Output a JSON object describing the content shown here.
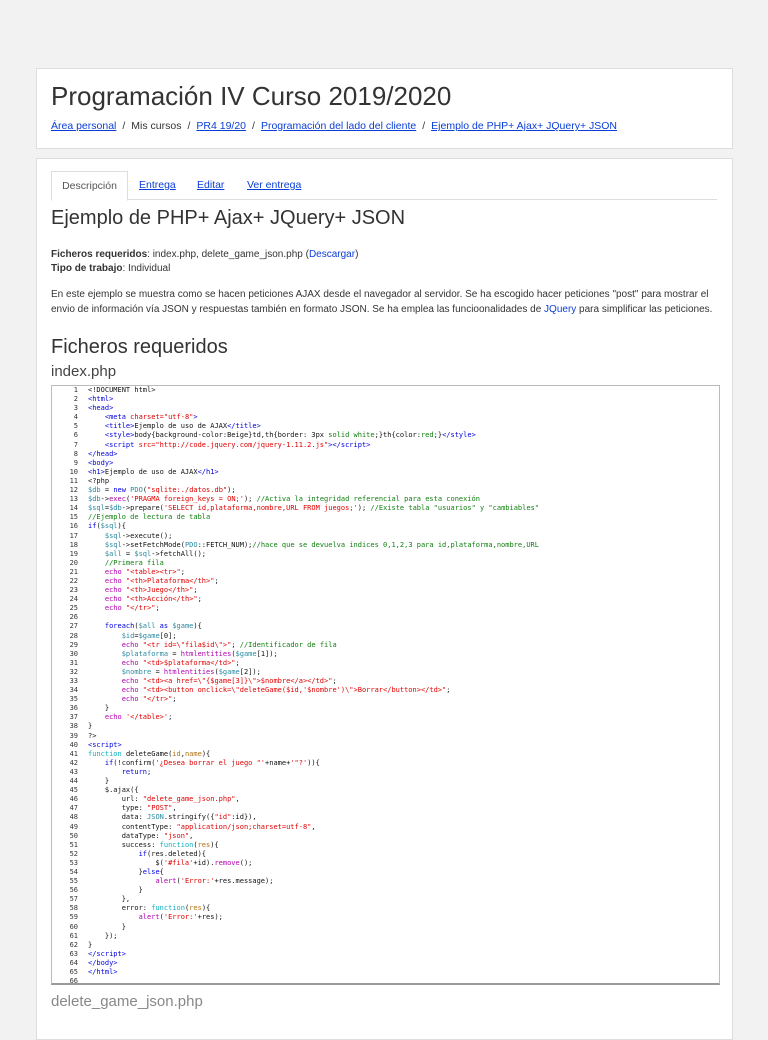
{
  "header": {
    "title": "Programación IV Curso 2019/2020",
    "breadcrumb": [
      "Área personal",
      "Mis cursos",
      "PR4 19/20",
      "Programación del lado del cliente",
      "Ejemplo de PHP+ Ajax+ JQuery+ JSON"
    ]
  },
  "tabs": [
    "Descripción",
    "Entrega",
    "Editar",
    "Ver entrega"
  ],
  "assignment": {
    "title": "Ejemplo de PHP+ Ajax+ JQuery+ JSON",
    "files_label": "Ficheros requeridos",
    "files_value": ": index.php, delete_game_json.php (",
    "download_link": "Descargar",
    "files_close": ")",
    "type_label": "Tipo de trabajo",
    "type_value": ": Individual",
    "description_pre": "En este ejemplo se muestra como se hacen peticiones AJAX  desde el navegador al servidor. Se ha escogido hacer peticiones \"post\" para mostrar el envio de información vía JSON y respuestas también en formato JSON. Se ha emplea las funcioonalidades de ",
    "description_link": "JQuery",
    "description_post": " para simplificar las peticiones.",
    "section_title": "Ficheros requeridos",
    "file1_name": "index.php",
    "file2_name": "delete_game_json.php"
  },
  "code_lines": [
    [
      [
        "",
        "<!DOCUMENT html>"
      ]
    ],
    [
      [
        "t",
        "<html>"
      ]
    ],
    [
      [
        "t",
        "<head>"
      ]
    ],
    [
      [
        "",
        "    "
      ],
      [
        "t",
        "<meta "
      ],
      [
        "s",
        "charset=\"utf-8\""
      ],
      [
        "t",
        ">"
      ]
    ],
    [
      [
        "",
        "    "
      ],
      [
        "t",
        "<title>"
      ],
      [
        "",
        "Ejemplo de uso de AJAX"
      ],
      [
        "t",
        "</title>"
      ]
    ],
    [
      [
        "",
        "    "
      ],
      [
        "t",
        "<style>"
      ],
      [
        "",
        "body{background-color:Beige}td,th{border: 3px "
      ],
      [
        "c",
        "solid white"
      ],
      [
        "",
        ";}th{color:"
      ],
      [
        "c",
        "red"
      ],
      [
        "",
        ";}"
      ],
      [
        "t",
        "</style>"
      ]
    ],
    [
      [
        "",
        "    "
      ],
      [
        "t",
        "<script "
      ],
      [
        "s",
        "src=\"http://code.jquery.com/jquery-1.11.2.js\""
      ],
      [
        "t",
        "></script>"
      ]
    ],
    [
      [
        "t",
        "</head>"
      ]
    ],
    [
      [
        "t",
        "<body>"
      ]
    ],
    [
      [
        "t",
        "<h1>"
      ],
      [
        "",
        "Ejemplo de uso de AJAX"
      ],
      [
        "t",
        "</h1>"
      ]
    ],
    [
      [
        "",
        "<?php"
      ]
    ],
    [
      [
        "v",
        "$db"
      ],
      [
        "",
        " = "
      ],
      [
        "t",
        "new "
      ],
      [
        "v",
        "PDO"
      ],
      [
        "",
        "("
      ],
      [
        "s",
        "\"sqlite:./datos.db\""
      ],
      [
        "",
        ");"
      ]
    ],
    [
      [
        "v",
        "$db"
      ],
      [
        "",
        "->"
      ],
      [
        "k",
        "exec"
      ],
      [
        "",
        "("
      ],
      [
        "s",
        "'PRAGMA foreign_keys = ON;'"
      ],
      [
        "",
        "); "
      ],
      [
        "c",
        "//Activa la integridad referencial para esta conexión"
      ]
    ],
    [
      [
        "v",
        "$sql"
      ],
      [
        "",
        "="
      ],
      [
        "v",
        "$db"
      ],
      [
        "",
        "->prepare("
      ],
      [
        "s",
        "'SELECT id,plataforma,nombre,URL FROM juegos;'"
      ],
      [
        "",
        "); "
      ],
      [
        "c",
        "//Existe tabla \"usuarios\" y \"cambiables\""
      ]
    ],
    [
      [
        "c",
        "//Ejemplo de lectura de tabla"
      ]
    ],
    [
      [
        "t",
        "if"
      ],
      [
        "",
        "("
      ],
      [
        "v",
        "$sql"
      ],
      [
        "",
        "){"
      ]
    ],
    [
      [
        "",
        "    "
      ],
      [
        "v",
        "$sql"
      ],
      [
        "",
        "->execute();"
      ]
    ],
    [
      [
        "",
        "    "
      ],
      [
        "v",
        "$sql"
      ],
      [
        "",
        "->setFetchMode("
      ],
      [
        "v",
        "PDO"
      ],
      [
        "",
        "::FETCH_NUM);"
      ],
      [
        "c",
        "//hace que se devuelva indices 0,1,2,3 para id,plataforma,nombre,URL"
      ]
    ],
    [
      [
        "",
        "    "
      ],
      [
        "v",
        "$all"
      ],
      [
        "",
        " = "
      ],
      [
        "v",
        "$sql"
      ],
      [
        "",
        "->fetchAll();"
      ]
    ],
    [
      [
        "",
        "    "
      ],
      [
        "c",
        "//Primera fila"
      ]
    ],
    [
      [
        "",
        "    "
      ],
      [
        "k",
        "echo "
      ],
      [
        "s",
        "\"<table><tr>\""
      ],
      [
        "",
        ";"
      ]
    ],
    [
      [
        "",
        "    "
      ],
      [
        "k",
        "echo "
      ],
      [
        "s",
        "\"<th>Plataforma</th>\""
      ],
      [
        "",
        ";"
      ]
    ],
    [
      [
        "",
        "    "
      ],
      [
        "k",
        "echo "
      ],
      [
        "s",
        "\"<th>Juego</th>\""
      ],
      [
        "",
        ";"
      ]
    ],
    [
      [
        "",
        "    "
      ],
      [
        "k",
        "echo "
      ],
      [
        "s",
        "\"<th>Acción</th>\""
      ],
      [
        "",
        ";"
      ]
    ],
    [
      [
        "",
        "    "
      ],
      [
        "k",
        "echo "
      ],
      [
        "s",
        "\"</tr>\""
      ],
      [
        "",
        ";"
      ]
    ],
    [
      [
        "",
        ""
      ]
    ],
    [
      [
        "",
        "    "
      ],
      [
        "t",
        "foreach"
      ],
      [
        "",
        "("
      ],
      [
        "v",
        "$all"
      ],
      [
        "t",
        " as "
      ],
      [
        "v",
        "$game"
      ],
      [
        "",
        "){"
      ]
    ],
    [
      [
        "",
        "        "
      ],
      [
        "v",
        "$id"
      ],
      [
        "",
        "="
      ],
      [
        "v",
        "$game"
      ],
      [
        "",
        "[0];"
      ]
    ],
    [
      [
        "",
        "        "
      ],
      [
        "k",
        "echo "
      ],
      [
        "s",
        "\"<tr id=\\\"fila$id\\\">\""
      ],
      [
        "",
        "; "
      ],
      [
        "c",
        "//Identificador de fila"
      ]
    ],
    [
      [
        "",
        "        "
      ],
      [
        "v",
        "$plataforma"
      ],
      [
        "",
        " = "
      ],
      [
        "k",
        "htmlentities"
      ],
      [
        "",
        "("
      ],
      [
        "v",
        "$game"
      ],
      [
        "",
        "[1]);"
      ]
    ],
    [
      [
        "",
        "        "
      ],
      [
        "k",
        "echo "
      ],
      [
        "s",
        "\"<td>$plataforma</td>\""
      ],
      [
        "",
        ";"
      ]
    ],
    [
      [
        "",
        "        "
      ],
      [
        "v",
        "$nombre"
      ],
      [
        "",
        " = "
      ],
      [
        "k",
        "htmlentities"
      ],
      [
        "",
        "("
      ],
      [
        "v",
        "$game"
      ],
      [
        "",
        "[2]);"
      ]
    ],
    [
      [
        "",
        "        "
      ],
      [
        "k",
        "echo "
      ],
      [
        "s",
        "\"<td><a href=\\\"{$game[3]}\\\">$nombre</a></td>\""
      ],
      [
        "",
        ";"
      ]
    ],
    [
      [
        "",
        "        "
      ],
      [
        "k",
        "echo "
      ],
      [
        "s",
        "\"<td><button onclick=\\\"deleteGame($id,'$nombre')\\\">Borrar</button></td>\""
      ],
      [
        "",
        ";"
      ]
    ],
    [
      [
        "",
        "        "
      ],
      [
        "k",
        "echo "
      ],
      [
        "s",
        "\"</tr>\""
      ],
      [
        "",
        ";"
      ]
    ],
    [
      [
        "",
        "    }"
      ]
    ],
    [
      [
        "",
        "    "
      ],
      [
        "k",
        "echo "
      ],
      [
        "s",
        "'</table>'"
      ],
      [
        "",
        ";"
      ]
    ],
    [
      [
        "",
        "}"
      ]
    ],
    [
      [
        "",
        "?>"
      ]
    ],
    [
      [
        "t",
        "<script>"
      ]
    ],
    [
      [
        "f",
        "function "
      ],
      [
        "",
        "deleteGame("
      ],
      [
        "p",
        "id"
      ],
      [
        "",
        ","
      ],
      [
        "p",
        "name"
      ],
      [
        "",
        "){"
      ]
    ],
    [
      [
        "",
        "    "
      ],
      [
        "t",
        "if"
      ],
      [
        "",
        "(!confirm("
      ],
      [
        "s",
        "'¿Desea borrar el juego \"'"
      ],
      [
        "",
        "+name+"
      ],
      [
        "s",
        "'\"?'"
      ],
      [
        "",
        ")){"
      ]
    ],
    [
      [
        "",
        "        "
      ],
      [
        "t",
        "return"
      ],
      [
        "",
        ";"
      ]
    ],
    [
      [
        "",
        "    }"
      ]
    ],
    [
      [
        "",
        "    $.ajax({"
      ]
    ],
    [
      [
        "",
        "        url: "
      ],
      [
        "s",
        "\"delete_game_json.php\""
      ],
      [
        "",
        ","
      ]
    ],
    [
      [
        "",
        "        type: "
      ],
      [
        "s",
        "\"POST\""
      ],
      [
        "",
        ","
      ]
    ],
    [
      [
        "",
        "        data: "
      ],
      [
        "v",
        "JSON"
      ],
      [
        "",
        ".stringify({"
      ],
      [
        "s",
        "\"id\""
      ],
      [
        "",
        ":id}),"
      ]
    ],
    [
      [
        "",
        "        contentType: "
      ],
      [
        "s",
        "\"application/json;charset=utf-8\""
      ],
      [
        "",
        ","
      ]
    ],
    [
      [
        "",
        "        dataType: "
      ],
      [
        "s",
        "\"json\""
      ],
      [
        "",
        ","
      ]
    ],
    [
      [
        "",
        "        success: "
      ],
      [
        "f",
        "function"
      ],
      [
        "",
        "("
      ],
      [
        "p",
        "res"
      ],
      [
        "",
        "){"
      ]
    ],
    [
      [
        "",
        "            "
      ],
      [
        "t",
        "if"
      ],
      [
        "",
        "(res.deleted){"
      ]
    ],
    [
      [
        "",
        "                $("
      ],
      [
        "s",
        "'#fila'"
      ],
      [
        "",
        "+id)."
      ],
      [
        "k",
        "remove"
      ],
      [
        "",
        "();"
      ]
    ],
    [
      [
        "",
        "            }"
      ],
      [
        "t",
        "else"
      ],
      [
        "",
        "{"
      ]
    ],
    [
      [
        "",
        "                "
      ],
      [
        "k",
        "alert"
      ],
      [
        "",
        "("
      ],
      [
        "s",
        "'Error:'"
      ],
      [
        "",
        "+res.message);"
      ]
    ],
    [
      [
        "",
        "            }"
      ]
    ],
    [
      [
        "",
        "        },"
      ]
    ],
    [
      [
        "",
        "        error: "
      ],
      [
        "f",
        "function"
      ],
      [
        "",
        "("
      ],
      [
        "p",
        "res"
      ],
      [
        "",
        "){"
      ]
    ],
    [
      [
        "",
        "            "
      ],
      [
        "k",
        "alert"
      ],
      [
        "",
        "("
      ],
      [
        "s",
        "'Error:'"
      ],
      [
        "",
        "+res);"
      ]
    ],
    [
      [
        "",
        "        }"
      ]
    ],
    [
      [
        "",
        "    });"
      ]
    ],
    [
      [
        "",
        "}"
      ]
    ],
    [
      [
        "t",
        "</script>"
      ]
    ],
    [
      [
        "t",
        "</body>"
      ]
    ],
    [
      [
        "t",
        "</html>"
      ]
    ],
    [
      [
        "",
        ""
      ]
    ]
  ]
}
